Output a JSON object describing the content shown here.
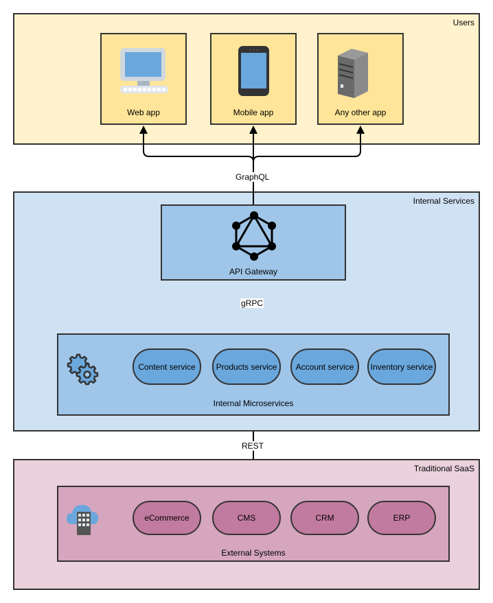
{
  "colors": {
    "users_zone": "#fff2cc",
    "app_card": "#ffe599",
    "internal_zone": "#cfe2f3",
    "internal_box": "#9fc5e8",
    "service_pill": "#6aa7dc",
    "saas_zone": "#ead1dc",
    "external_box": "#d5a6bd",
    "external_pill": "#c27ba0",
    "border": "#333333"
  },
  "users": {
    "title": "Users",
    "apps": [
      {
        "label": "Web app",
        "icon": "desktop-computer-icon"
      },
      {
        "label": "Mobile app",
        "icon": "smartphone-icon"
      },
      {
        "label": "Any other app",
        "icon": "server-tower-icon"
      }
    ]
  },
  "edges": {
    "users_gateway": "GraphQL",
    "gateway_services": "gRPC",
    "services_external": "REST"
  },
  "internal": {
    "title": "Internal Services",
    "gateway": {
      "label": "API Gateway",
      "icon": "graphql-logo-icon"
    },
    "microservices": {
      "label": "Internal Microservices",
      "icon": "gears-icon",
      "items": [
        "Content service",
        "Products service",
        "Account service",
        "Inventory service"
      ]
    }
  },
  "saas": {
    "title": "Traditional SaaS",
    "external": {
      "label": "External Systems",
      "icon": "cloud-building-icon",
      "items": [
        "eCommerce",
        "CMS",
        "CRM",
        "ERP"
      ]
    }
  }
}
